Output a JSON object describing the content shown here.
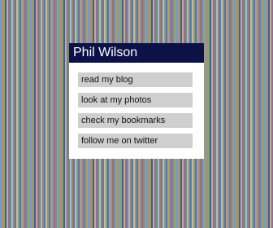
{
  "panel": {
    "title": "Phil Wilson",
    "links": [
      "read my blog",
      "look at my photos",
      "check my bookmarks",
      "follow me on twitter"
    ]
  },
  "colors": {
    "header_background": "#0c1148",
    "header_text": "#ffffff",
    "panel_background": "#ffffff",
    "link_background": "#cfcfcf",
    "link_text": "#111111"
  }
}
